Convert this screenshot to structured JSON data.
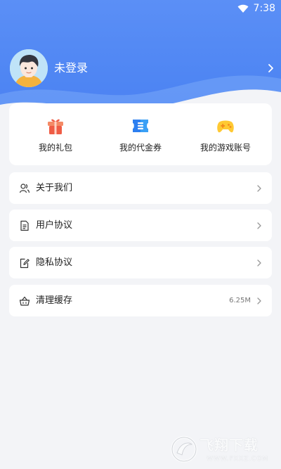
{
  "status_bar": {
    "time": "7:38",
    "wifi_icon": "wifi-icon"
  },
  "profile": {
    "login_text": "未登录",
    "avatar_icon": "avatar-icon"
  },
  "quick_actions": [
    {
      "label": "我的礼包",
      "icon": "gift-icon",
      "color": "#f1644b"
    },
    {
      "label": "我的代金券",
      "icon": "voucher-icon",
      "color": "#3ba7f4"
    },
    {
      "label": "我的游戏账号",
      "icon": "gamepad-icon",
      "color": "#ffc734"
    }
  ],
  "menu": [
    {
      "label": "关于我们",
      "icon": "users-icon"
    },
    {
      "label": "用户协议",
      "icon": "document-icon"
    },
    {
      "label": "隐私协议",
      "icon": "edit-document-icon"
    },
    {
      "label": "清理缓存",
      "icon": "basket-icon",
      "value": "6.25M"
    }
  ],
  "watermark": {
    "title": "飞翔下载",
    "url": "WWW.FXXZ.COM"
  },
  "colors": {
    "header_blue": "#4f86f3",
    "background": "#f3f4f7"
  }
}
